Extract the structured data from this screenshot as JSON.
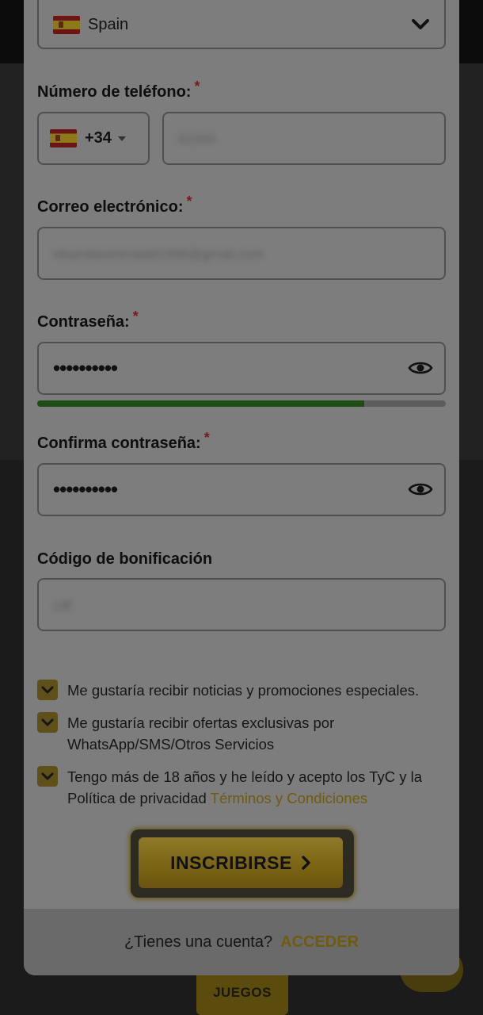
{
  "background": {
    "tab_label": "JUEGOS"
  },
  "country_select": {
    "flag": "spain-flag-icon",
    "value": "Spain"
  },
  "phone": {
    "label": "Número de teléfono:",
    "required_mark": "*",
    "country_code": "+34",
    "value": "62300"
  },
  "email": {
    "label": "Correo electrónico:",
    "required_mark": "*",
    "value": "vikandaserenaidd1998@gmail.com"
  },
  "password": {
    "label": "Contraseña:",
    "required_mark": "*",
    "value": "••••••••••",
    "strength": 0.8,
    "strength_color": "#1e4d14"
  },
  "confirm_password": {
    "label": "Confirma contraseña:",
    "required_mark": "*",
    "value": "••••••••••"
  },
  "bonus_code": {
    "label": "Código de bonificación",
    "placeholder": "cdf"
  },
  "checkboxes": [
    {
      "text": "Me gustaría recibir noticias y promociones especiales.",
      "checked": true
    },
    {
      "text": "Me gustaría recibir ofertas exclusivas por WhatsApp/SMS/Otros Servicios",
      "checked": true
    },
    {
      "text_before": "Tengo más de 18 años y he leído y acepto los TyC y la Política de privacidad",
      "link": "Términos y Condiciones",
      "checked": true
    }
  ],
  "submit": {
    "label": "INSCRIBIRSE",
    "icon": "chevron-right-icon"
  },
  "footer": {
    "question": "¿Tienes una cuenta?",
    "link": "ACCEDER"
  },
  "colors": {
    "accent": "#c99b1e",
    "overlay_panel": "#7d7d7d",
    "required": "#7a1a1a"
  }
}
